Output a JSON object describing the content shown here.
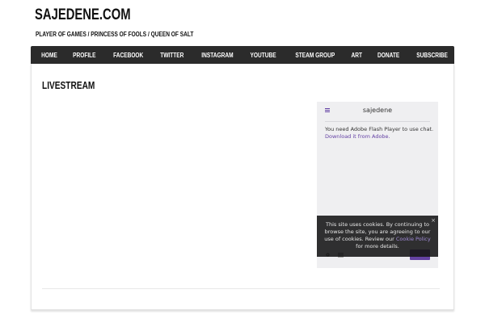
{
  "site": {
    "title": "SAJEDENE.COM",
    "tagline": "PLAYER OF GAMES / PRINCESS OF FOOLS / QUEEN OF SALT"
  },
  "nav": {
    "items": [
      {
        "label": "HOME"
      },
      {
        "label": "PROFILE"
      },
      {
        "label": "FACEBOOK"
      },
      {
        "label": "TWITTER"
      },
      {
        "label": "INSTAGRAM"
      },
      {
        "label": "YOUTUBE"
      },
      {
        "label": "STEAM GROUP"
      },
      {
        "label": "ART"
      },
      {
        "label": "DONATE"
      },
      {
        "label": "SUBSCRIBE"
      }
    ]
  },
  "page": {
    "title": "LIVESTREAM"
  },
  "chat": {
    "channel": "sajedene",
    "message": "You need Adobe Flash Player to use chat.",
    "link": "Download it from Adobe.",
    "accent": "#6441a4"
  },
  "cookie": {
    "text_before": "This site uses cookies. By continuing to browse the site, you are agreeing to our use of cookies. Review our",
    "link": "Cookie Policy",
    "text_after": "for more details.",
    "close": "×"
  }
}
